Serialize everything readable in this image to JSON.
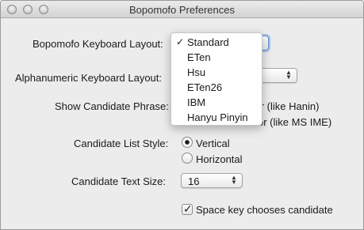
{
  "window": {
    "title": "Bopomofo Preferences"
  },
  "keyboard_layout": {
    "label": "Bopomofo Keyboard Layout:",
    "selected": "Standard",
    "options": [
      "Standard",
      "ETen",
      "Hsu",
      "ETen26",
      "IBM",
      "Hanyu Pinyin"
    ]
  },
  "alphanumeric_layout": {
    "label": "Alphanumeric Keyboard Layout:"
  },
  "candidate_phrase": {
    "label": "Show Candidate Phrase:",
    "option1_visible": "sor (like Hanin)",
    "option2_visible": "or (like MS IME)"
  },
  "list_style": {
    "label": "Candidate List Style:",
    "options": [
      "Vertical",
      "Horizontal"
    ],
    "selected": "Vertical"
  },
  "text_size": {
    "label": "Candidate Text Size:",
    "value": "16"
  },
  "space_key": {
    "label": "Space key chooses candidate",
    "checked": true
  },
  "icons": {
    "checkmark": "✓",
    "popup_arrows": "▲▼"
  }
}
